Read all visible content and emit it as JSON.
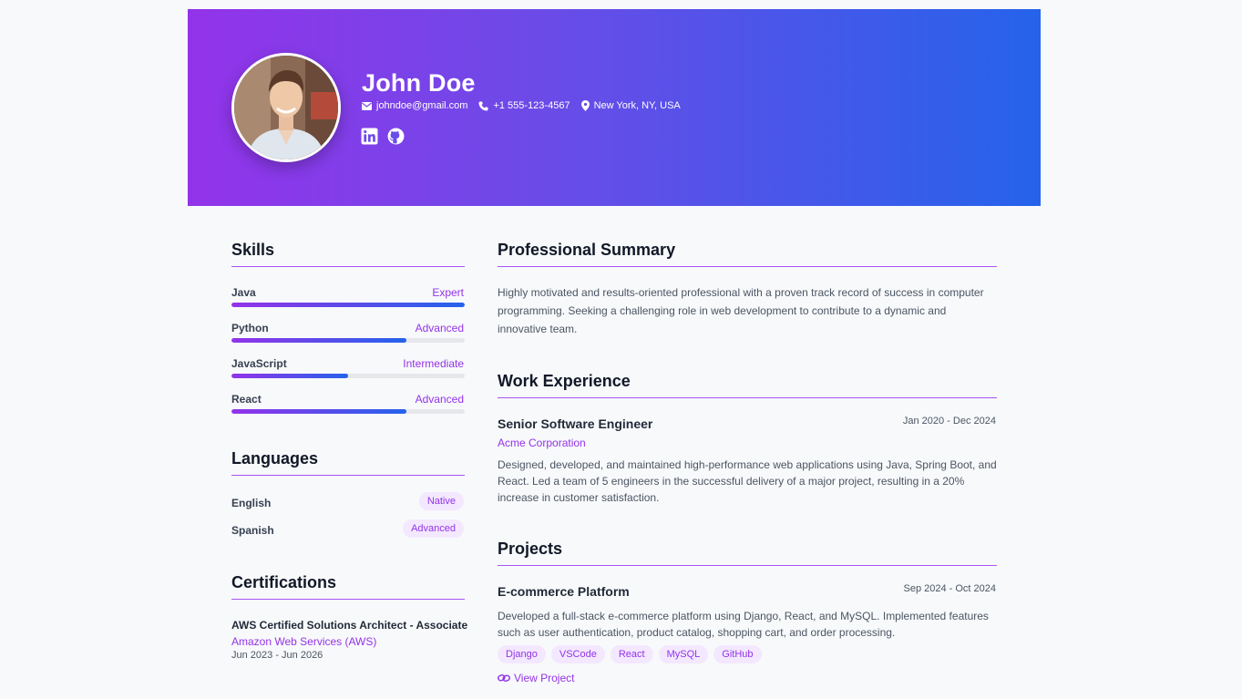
{
  "header": {
    "name": "John Doe",
    "email": "johndoe@gmail.com",
    "phone": "+1 555-123-4567",
    "location": "New York, NY, USA",
    "icons": [
      "envelope-icon",
      "phone-icon",
      "map-pin-icon",
      "linkedin-icon",
      "github-icon"
    ]
  },
  "skills": {
    "title": "Skills",
    "items": [
      {
        "name": "Java",
        "level": "Expert",
        "fraction": 1.0
      },
      {
        "name": "Python",
        "level": "Advanced",
        "fraction": 0.75
      },
      {
        "name": "JavaScript",
        "level": "Intermediate",
        "fraction": 0.5
      },
      {
        "name": "React",
        "level": "Advanced",
        "fraction": 0.75
      }
    ]
  },
  "languages": {
    "title": "Languages",
    "items": [
      {
        "name": "English",
        "level": "Native"
      },
      {
        "name": "Spanish",
        "level": "Advanced"
      }
    ]
  },
  "certifications": {
    "title": "Certifications",
    "items": [
      {
        "title": "AWS Certified Solutions Architect - Associate",
        "issuer": "Amazon Web Services (AWS)",
        "dates": "Jun 2023 - Jun 2026"
      }
    ]
  },
  "summary": {
    "title": "Professional Summary",
    "text": "Highly motivated and results-oriented professional with a proven track record of success in computer programming. Seeking a challenging role in web development to contribute to a dynamic and innovative team."
  },
  "experience": {
    "title": "Work Experience",
    "items": [
      {
        "role": "Senior Software Engineer",
        "dates": "Jan 2020 - Dec 2024",
        "company": "Acme Corporation",
        "description": "Designed, developed, and maintained high-performance web applications using Java, Spring Boot, and React. Led a team of 5 engineers in the successful delivery of a major project, resulting in a 20% increase in customer satisfaction."
      }
    ]
  },
  "projects": {
    "title": "Projects",
    "items": [
      {
        "name": "E-commerce Platform",
        "dates": "Sep 2024 - Oct 2024",
        "description": "Developed a full-stack e-commerce platform using Django, React, and MySQL. Implemented features such as user authentication, product catalog, shopping cart, and order processing.",
        "tags": [
          "Django",
          "VSCode",
          "React",
          "MySQL",
          "GitHub"
        ],
        "link_label": "View Project"
      }
    ]
  },
  "colors": {
    "accent": "#9333ea",
    "gradient_start": "#9333ea",
    "gradient_end": "#2563eb"
  }
}
